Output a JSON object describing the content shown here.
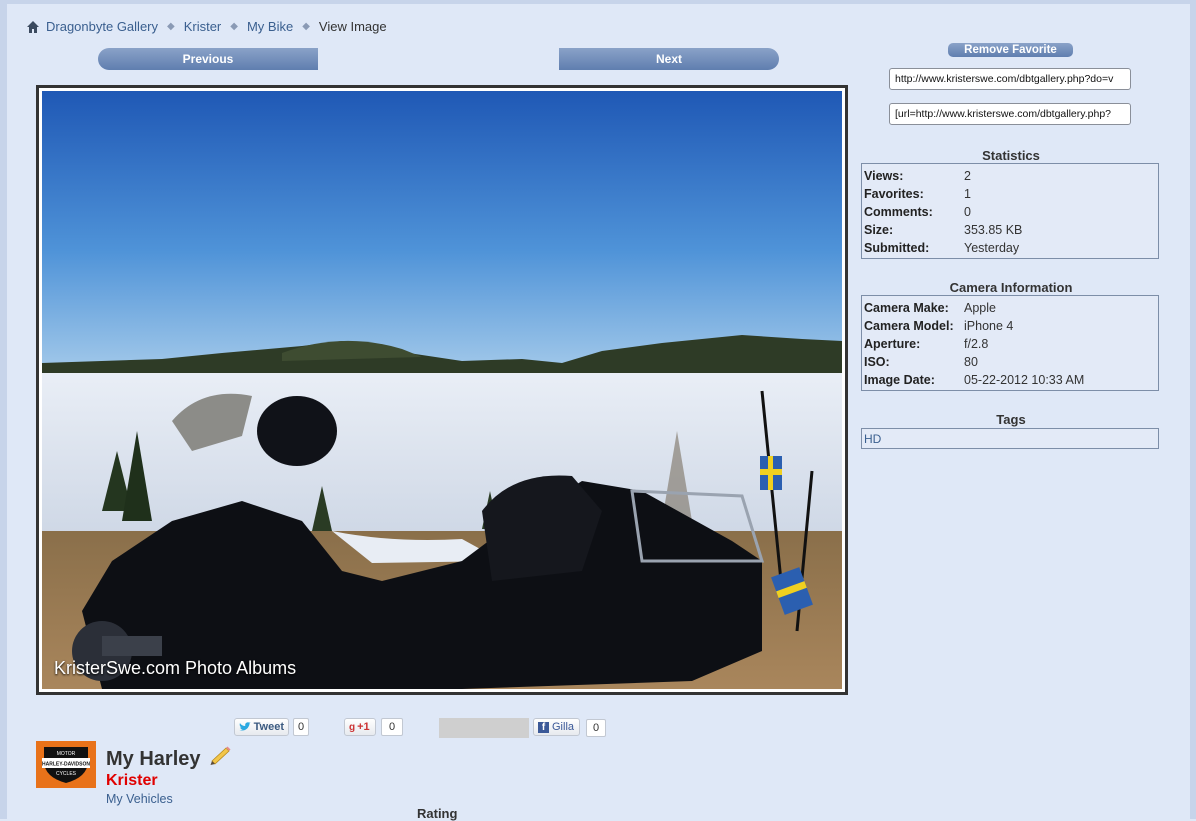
{
  "breadcrumb": {
    "home_icon": "home-icon",
    "items": [
      "Dragonbyte Gallery",
      "Krister",
      "My Bike"
    ],
    "current": "View Image"
  },
  "nav": {
    "previous_label": "Previous",
    "next_label": "Next"
  },
  "image": {
    "watermark": "KristerSwe.com Photo Albums"
  },
  "sidebar": {
    "remove_favorite_label": "Remove Favorite",
    "url_field": "http://www.kristerswe.com/dbtgallery.php?do=v",
    "bbcode_field": "[url=http://www.kristerswe.com/dbtgallery.php?",
    "statistics_title": "Statistics",
    "statistics": [
      {
        "k": "Views:",
        "v": "2"
      },
      {
        "k": "Favorites:",
        "v": "1"
      },
      {
        "k": "Comments:",
        "v": "0"
      },
      {
        "k": "Size:",
        "v": "353.85 KB"
      },
      {
        "k": "Submitted:",
        "v": "Yesterday"
      }
    ],
    "camera_title": "Camera Information",
    "camera": [
      {
        "k": "Camera Make:",
        "v": "Apple"
      },
      {
        "k": "Camera Model:",
        "v": "iPhone 4"
      },
      {
        "k": "Aperture:",
        "v": "f/2.8"
      },
      {
        "k": "ISO:",
        "v": "80"
      },
      {
        "k": "Image Date:",
        "v": "05-22-2012 10:33 AM"
      }
    ],
    "tags_title": "Tags",
    "tags": "HD"
  },
  "social": {
    "tweet_label": "Tweet",
    "tweet_count": "0",
    "gplus_label": "+1",
    "gplus_count": "0",
    "fb_label": "Gilla",
    "fb_count": "0"
  },
  "album": {
    "title": "My Harley",
    "owner": "Krister",
    "category": "My Vehicles",
    "rating_label": "Rating",
    "thumb_text": [
      "MOTOR",
      "HARLEY-DAVIDSON",
      "CYCLES"
    ]
  },
  "colors": {
    "background": "#dfe8f7",
    "button": "#6f8cba",
    "link": "#3a5f8f",
    "owner": "#e00000"
  }
}
